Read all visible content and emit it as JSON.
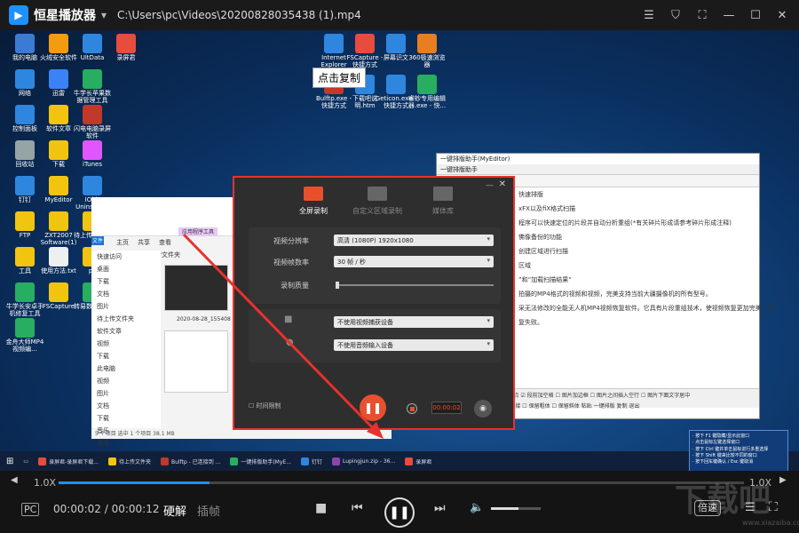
{
  "titlebar": {
    "app_name": "恒星播放器",
    "file_path": "C:\\Users\\pc\\Videos\\20200828035438 (1).mp4"
  },
  "desktop": {
    "icons_left": [
      {
        "label": "我的电脑",
        "color": "#3a7bd5"
      },
      {
        "label": "火绒安全软件",
        "color": "#f39c12"
      },
      {
        "label": "UltData",
        "color": "#2e86de"
      },
      {
        "label": "录屏君",
        "color": "#e74c3c"
      },
      {
        "label": "网络",
        "color": "#2e86de"
      },
      {
        "label": "迅雷",
        "color": "#3b82f6"
      },
      {
        "label": "牛学长苹果数据管理工具",
        "color": "#27ae60"
      },
      {
        "label": "控制面板",
        "color": "#2e86de"
      },
      {
        "label": "软件文章",
        "color": "#f1c40f"
      },
      {
        "label": "闪电电脑录屏软件",
        "color": "#c0392b"
      },
      {
        "label": "回收站",
        "color": "#95a5a6"
      },
      {
        "label": "下载",
        "color": "#f1c40f"
      },
      {
        "label": "iTunes",
        "color": "#e056fd"
      },
      {
        "label": "钉钉",
        "color": "#2e86de"
      },
      {
        "label": "MyEditor",
        "color": "#f1c40f"
      },
      {
        "label": "IObit Uninstaller",
        "color": "#2e86de"
      },
      {
        "label": "FTP",
        "color": "#f1c40f"
      },
      {
        "label": "ZXT2007 Software(1)",
        "color": "#f1c40f"
      },
      {
        "label": "待上传文件夹",
        "color": "#f1c40f"
      },
      {
        "label": "工具",
        "color": "#f1c40f"
      },
      {
        "label": "使用方法.txt",
        "color": "#ecf0f1"
      },
      {
        "label": "pc",
        "color": "#f1c40f"
      },
      {
        "label": "牛学长安卓手机修复工具",
        "color": "#27ae60"
      },
      {
        "label": "FSCapture",
        "color": "#f1c40f"
      },
      {
        "label": "转易数据恢复",
        "color": "#27ae60"
      },
      {
        "label": "金舟大师MP4视频编...",
        "color": "#27ae60"
      }
    ],
    "icons_top": [
      {
        "label": "Internet Explorer",
        "color": "#2e86de"
      },
      {
        "label": "FSCapture - 快捷方式",
        "color": "#e74c3c"
      },
      {
        "label": "屏幕识文",
        "color": "#2e86de"
      },
      {
        "label": "360极速浏览器",
        "color": "#e67e22"
      },
      {
        "label": "Bulftp.exe - 快捷方式",
        "color": "#c0392b"
      },
      {
        "label": "下载吧说明.htm",
        "color": "#2e86de"
      },
      {
        "label": "Geticon.exe - 快捷方式",
        "color": "#2e86de"
      },
      {
        "label": "睿妙专用编辑器.exe - 快...",
        "color": "#27ae60"
      }
    ],
    "tooltip": "点击复制"
  },
  "explorer": {
    "tabs": [
      "文件",
      "主页",
      "共享",
      "查看"
    ],
    "context_tab": "应用程序工具",
    "address": "待上传文件夹",
    "sidebar": [
      "快速访问",
      "桌面",
      "下载",
      "文档",
      "图片",
      "待上传文件夹",
      "软件文章",
      "视频",
      "下载",
      "此电脑",
      "视频",
      "图片",
      "文档",
      "下载",
      "音乐",
      "桌面"
    ],
    "file_label": "2020-08-28_155408",
    "status": "5 个项目    选中 1 个项目 38.1 MB"
  },
  "editor": {
    "title": "一键排版助手(MyEditor)",
    "menu": "一键排版助手",
    "lines": [
      "快速排版",
      "xFX以及fiX格式扫描",
      "程序可以快速定位的片段并自动分析重组(*有关碎片形成请参考碎片形成注释)",
      "佛像备份的功能",
      "创建区域进行扫描",
      "区域",
      "”和“加载扫描结果”",
      "拍摄的MP4格式的视频和视频，完美支持当前大疆摄像机的所有型号。",
      "采无法修改的全能无人机MP4视频恢复软件。它具有片段重组技术，使视频恢复更加完美，原",
      "复失败。"
    ],
    "bottom_row1": "☑ 新行首字空格  ☐ 禁止修改标点  ☑ 段前加空格  ☐ 图片加边框  ☐ 图片之间插入空行  ☐ 图片下面文字居中",
    "bottom_row2": "首行缩进  ☐ 保留表格  ☐ 保留链接  ☐ 保留粗体  ☐ 保留斜体   粘贴   一键排版   复制  退出"
  },
  "recorder": {
    "tabs": [
      {
        "label": "全屏录制",
        "active": true
      },
      {
        "label": "自定义区域录制",
        "active": false
      },
      {
        "label": "媒体库",
        "active": false
      }
    ],
    "settings": [
      {
        "label": "视频分辨率",
        "value": "高清 (1080P)   1920x1080"
      },
      {
        "label": "视频帧数率",
        "value": "30 帧 / 秒"
      },
      {
        "label": "录制质量",
        "value": ""
      }
    ],
    "devices": [
      {
        "value": "不使用视频捕获设备"
      },
      {
        "value": "不使用音频输入设备"
      }
    ],
    "timed_record": "时间限制",
    "timer": "00:00:02"
  },
  "taskbar": {
    "items": [
      {
        "label": "录屏君-录屏君下载...",
        "color": "#e74c3c"
      },
      {
        "label": "待上传文件夹",
        "color": "#f1c40f"
      },
      {
        "label": "Bulftp - 已连接到 ...",
        "color": "#c0392b"
      },
      {
        "label": "一键排版助手(MyE...",
        "color": "#27ae60"
      },
      {
        "label": "钉钉",
        "color": "#2e86de"
      },
      {
        "label": "Lupingjun.zip - 36...",
        "color": "#8e44ad"
      },
      {
        "label": "录屏君",
        "color": "#e74c3c"
      }
    ],
    "notice_lines": [
      "· 按下 F1 键隐藏/显示此窗口",
      "· 点击鼠标左键选择窗口",
      "· 按下 Ctrl 键并单击鼠标进行多重选择",
      "· 按下 Shift 键来比较不同的窗口",
      "· 按下回车键确认 / Esc 键取消"
    ]
  },
  "player": {
    "speed_left": "1.0X",
    "speed_right": "1.0X",
    "progress": 0.22,
    "time": "00:00:02 / 00:00:12",
    "decode_hw": "硬解",
    "frame": "插帧",
    "volume": 0.55,
    "speed_button": "倍速",
    "watermark": "下载吧",
    "watermark_url": "www.xiazaiba.com"
  },
  "colors": {
    "accent": "#1e90ff",
    "record_red": "#e8312d",
    "arrow_red": "#e8312d"
  }
}
